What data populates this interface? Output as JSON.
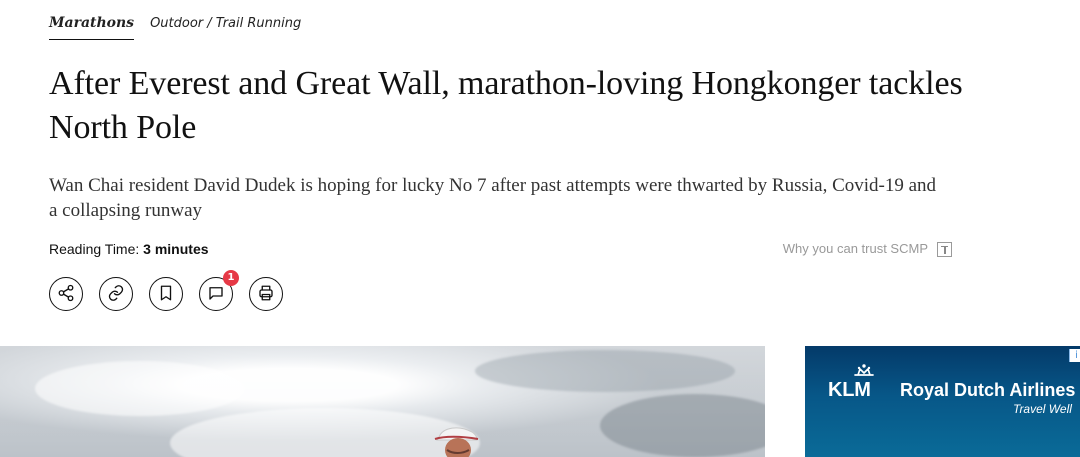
{
  "breadcrumbs": {
    "active": "Marathons",
    "secondary": "Outdoor / Trail Running"
  },
  "article": {
    "headline": "After Everest and Great Wall, marathon-loving Hongkonger tackles North Pole",
    "subhead": "Wan Chai resident David Dudek is hoping for lucky No 7 after past attempts were thwarted by Russia, Covid-19 and a collapsing runway",
    "reading_time_label": "Reading Time: ",
    "reading_time_value": "3 minutes",
    "trust_text": "Why you can trust SCMP"
  },
  "actions": {
    "share_icon": "share-icon",
    "link_icon": "link-icon",
    "bookmark_icon": "bookmark-icon",
    "comment_icon": "comment-icon",
    "comment_count": "1",
    "print_icon": "print-icon"
  },
  "advertisement": {
    "brand": "KLM",
    "title": "Royal Dutch Airlines",
    "tagline": "Travel Well"
  },
  "colors": {
    "badge": "#e63946",
    "ad_background": "#075788"
  }
}
